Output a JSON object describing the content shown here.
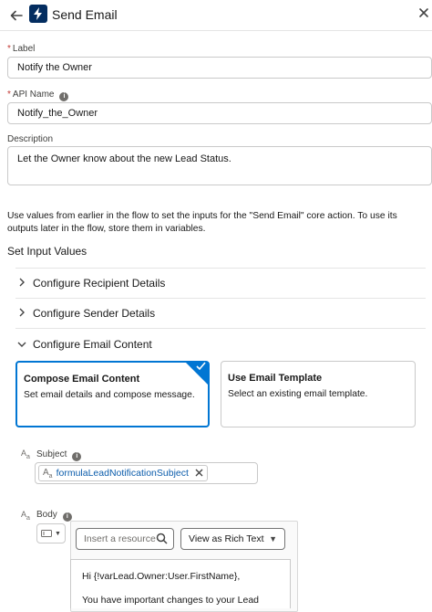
{
  "header": {
    "title": "Send Email"
  },
  "label_field": {
    "label": "Label",
    "value": "Notify the Owner"
  },
  "api_field": {
    "label": "API Name",
    "value": "Notify_the_Owner"
  },
  "description_field": {
    "label": "Description",
    "value": "Let the Owner know about the new Lead Status."
  },
  "help_text": "Use values from earlier in the flow to set the inputs for the \"Send Email\" core action. To use its outputs later in the flow, store them in variables.",
  "input_values": {
    "title": "Set Input Values",
    "sections": [
      {
        "label": "Configure Recipient Details",
        "expanded": false
      },
      {
        "label": "Configure Sender Details",
        "expanded": false
      },
      {
        "label": "Configure Email Content",
        "expanded": true
      }
    ]
  },
  "content_cards": [
    {
      "title": "Compose Email Content",
      "description": "Set email details and compose message.",
      "selected": true
    },
    {
      "title": "Use Email Template",
      "description": "Select an existing email template.",
      "selected": false
    }
  ],
  "subject": {
    "label": "Subject",
    "pill_value": "formulaLeadNotificationSubject"
  },
  "body": {
    "label": "Body",
    "resource_placeholder": "Insert a resource",
    "view_mode": "View as Rich Text",
    "lines": [
      "Hi {!varLead.Owner:User.FirstName},",
      "",
      "You have important changes to your Lead"
    ]
  },
  "colors": {
    "brand": "#032d60",
    "selected_border": "#0176d3",
    "required": "#c23934"
  }
}
